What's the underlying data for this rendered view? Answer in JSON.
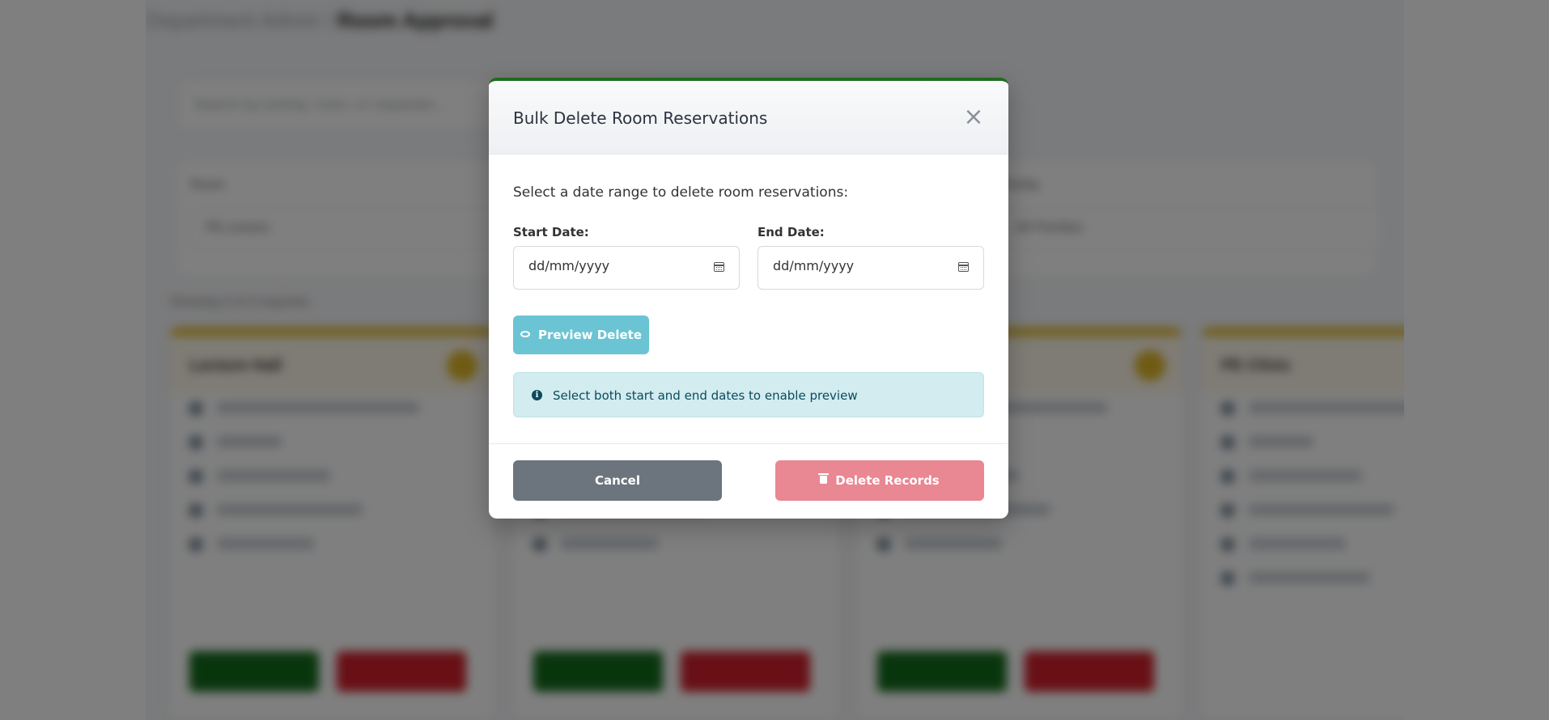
{
  "background": {
    "breadcrumb_parent": "Department Admin",
    "breadcrumb_sep": "/",
    "breadcrumb_current": "Room Approval",
    "search_placeholder": "Search by activity, room, or requester...",
    "filter_labels": [
      "Room",
      "Priority"
    ],
    "filter_values": [
      "PE Lecture",
      "All Priorities"
    ],
    "showing_text": "Showing 4 of 4 requests",
    "card_titles": [
      "Lecture Hall",
      "",
      "",
      "PE Clinic"
    ]
  },
  "modal": {
    "title": "Bulk Delete Room Reservations",
    "close_symbol": "×",
    "intro": "Select a date range to delete room reservations:",
    "start_label": "Start Date:",
    "end_label": "End Date:",
    "date_placeholder": "dd/mm/yyyy",
    "preview_label": "Preview Delete",
    "info_text": "Select both start and end dates to enable preview",
    "cancel_label": "Cancel",
    "delete_label": "Delete Records"
  },
  "colors": {
    "header_accent": "#1f6b1f",
    "preview_button": "#6bc4d4",
    "info_bg": "#d2ecf0",
    "info_text": "#0c4a5c",
    "cancel_button": "#6c757d",
    "delete_button": "#e98792"
  },
  "icons": {
    "close": "close-icon",
    "calendar": "calendar-icon",
    "preview": "eye-icon",
    "info": "info-circle-icon",
    "delete": "trash-icon"
  }
}
